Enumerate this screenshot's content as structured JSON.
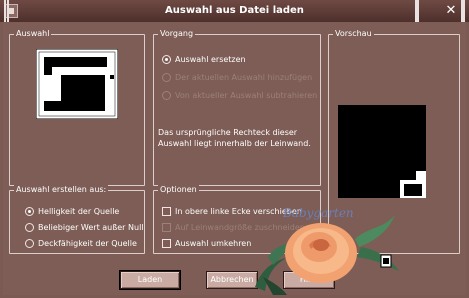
{
  "window": {
    "title": "Auswahl aus Datei laden",
    "close_glyph": "✕"
  },
  "auswahl_group": {
    "legend": "Auswahl"
  },
  "vorgang_group": {
    "legend": "Vorgang",
    "options": [
      {
        "label": "Auswahl ersetzen",
        "checked": true,
        "enabled": true
      },
      {
        "label": "Der aktuellen Auswahl hinzufügen",
        "checked": false,
        "enabled": false
      },
      {
        "label": "Von aktueller Auswahl subtrahieren",
        "checked": false,
        "enabled": false
      }
    ],
    "info": "Das ursprüngliche Rechteck dieser Auswahl liegt innerhalb der Leinwand."
  },
  "vorschau_group": {
    "legend": "Vorschau"
  },
  "erstellen_group": {
    "legend": "Auswahl erstellen aus:",
    "options": [
      {
        "label": "Helligkeit der Quelle",
        "checked": true
      },
      {
        "label": "Beliebiger Wert außer Null",
        "checked": false
      },
      {
        "label": "Deckfähigkeit der Quelle",
        "checked": false
      }
    ]
  },
  "optionen_group": {
    "legend": "Optionen",
    "options": [
      {
        "label": "In obere linke Ecke verschieben",
        "checked": false,
        "enabled": true
      },
      {
        "label": "Auf Leinwandgröße zuschneiden",
        "checked": false,
        "enabled": false
      },
      {
        "label": "Auswahl umkehren",
        "checked": false,
        "enabled": true
      }
    ]
  },
  "buttons": {
    "load": "Laden",
    "cancel": "Abbrechen",
    "help": "Hilfe"
  },
  "decoration": {
    "watermark_text": "Babygarten"
  },
  "colors": {
    "dialog_bg": "#7d5d55",
    "titlebar": "#4e2f2b",
    "button_face": "#c9aba4"
  }
}
